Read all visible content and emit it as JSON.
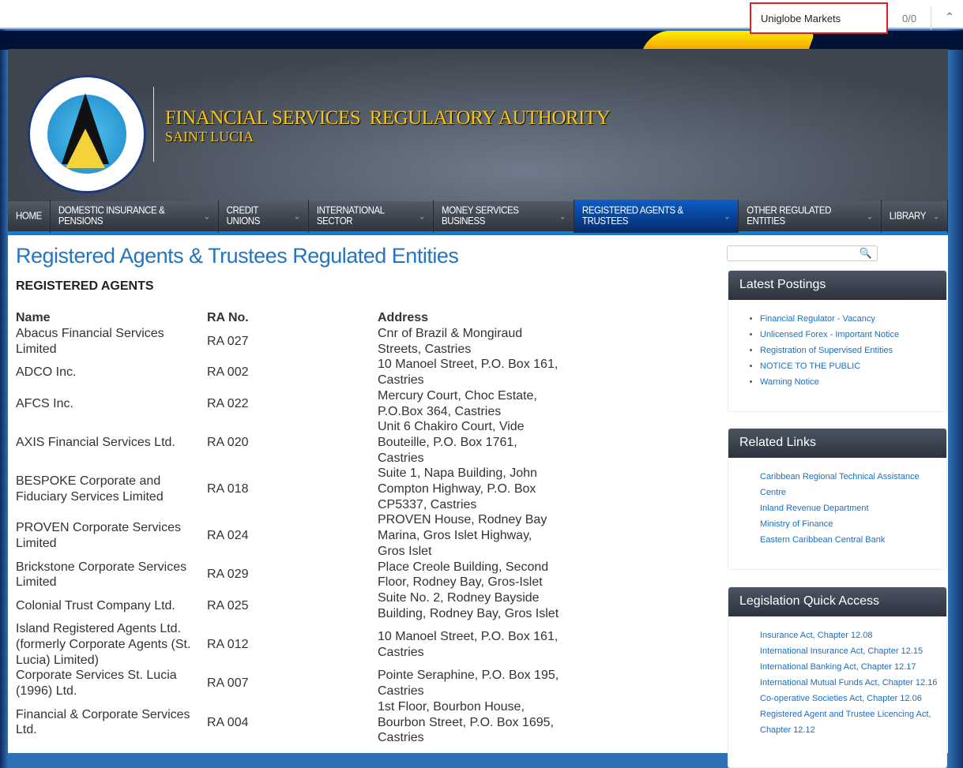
{
  "find_bar": {
    "query": "Uniglobe Markets",
    "count": "0/0",
    "up_icon": "chevron-up"
  },
  "header": {
    "org_name": "FINANCIAL SERVICES  REGULATORY AUTHORITY",
    "org_sub": "SAINT LUCIA",
    "logo_text": "FINANCIAL SERVICES REGULATORY AUTHORITY SAINT LUCIA"
  },
  "nav": [
    {
      "label": "HOME"
    },
    {
      "label": "DOMESTIC INSURANCE & PENSIONS"
    },
    {
      "label": "CREDIT UNIONS"
    },
    {
      "label": "INTERNATIONAL SECTOR"
    },
    {
      "label": "MONEY SERVICES BUSINESS"
    },
    {
      "label": "REGISTERED AGENTS & TRUSTEES"
    },
    {
      "label": "OTHER REGULATED ENTITIES"
    },
    {
      "label": "LIBRARY"
    }
  ],
  "main": {
    "title": "Registered Agents & Trustees Regulated Entities",
    "section": "REGISTERED AGENTS",
    "columns": [
      "Name",
      "RA No.",
      "Address"
    ],
    "rows": [
      [
        "Abacus Financial Services Limited",
        "RA 027",
        "Cnr of Brazil & Mongiraud Streets, Castries"
      ],
      [
        "ADCO Inc.",
        "RA 002",
        "10 Manoel Street, P.O. Box 161, Castries"
      ],
      [
        "AFCS Inc.",
        "RA 022",
        "Mercury Court, Choc Estate, P.O.Box 364, Castries"
      ],
      [
        "AXIS Financial Services Ltd.",
        "RA 020",
        "Unit 6 Chakiro Court, Vide Bouteille, P.O. Box 1761, Castries"
      ],
      [
        "BESPOKE Corporate and Fiduciary Services Limited",
        "RA 018",
        "Suite 1, Napa Building, John Compton Highway, P.O. Box CP5337, Castries"
      ],
      [
        "PROVEN Corporate Services Limited",
        "RA 024",
        "PROVEN House, Rodney Bay Marina, Gros Islet Highway, Gros Islet"
      ],
      [
        "Brickstone Corporate Services Limited",
        "RA 029",
        "Place Creole Building, Second Floor, Rodney Bay, Gros-Islet"
      ],
      [
        "Colonial Trust Company Ltd.",
        "RA 025",
        "Suite No. 2, Rodney Bayside Building, Rodney Bay, Gros Islet"
      ],
      [
        "Island Registered Agents Ltd. (formerly Corporate Agents (St. Lucia) Limited)",
        "RA 012",
        "10 Manoel Street, P.O. Box 161, Castries"
      ],
      [
        "Corporate Services St. Lucia (1996) Ltd.",
        "RA 007",
        "Pointe Seraphine, P.O. Box 195, Castries"
      ],
      [
        "Financial & Corporate Services Ltd.",
        "RA 004",
        "1st Floor, Bourbon House, Bourbon Street, P.O. Box 1695, Castries"
      ]
    ]
  },
  "sidebar": {
    "latest": {
      "title": "Latest Postings",
      "items": [
        "Financial Regulator - Vacancy",
        "Unlicensed Forex - Important Notice",
        "Registration of Supervised Entities",
        "NOTICE TO THE PUBLIC",
        "Warning Notice"
      ]
    },
    "related": {
      "title": "Related Links",
      "items": [
        "Caribbean Regional Technical Assistance Centre",
        "Inland Revenue Department",
        "Ministry of Finance",
        "Eastern Caribbean Central Bank"
      ]
    },
    "legislation": {
      "title": "Legislation Quick Access",
      "items": [
        "Insurance Act, Chapter 12.08",
        "International Insurance Act, Chapter 12.15",
        "International Banking Act, Chapter 12.17",
        "International Mutual Funds Act, Chapter 12.16",
        "Co-operative Societies Act, Chapter 12.06",
        "Registered Agent and Trustee Licencing Act, Chapter 12.12"
      ]
    }
  }
}
